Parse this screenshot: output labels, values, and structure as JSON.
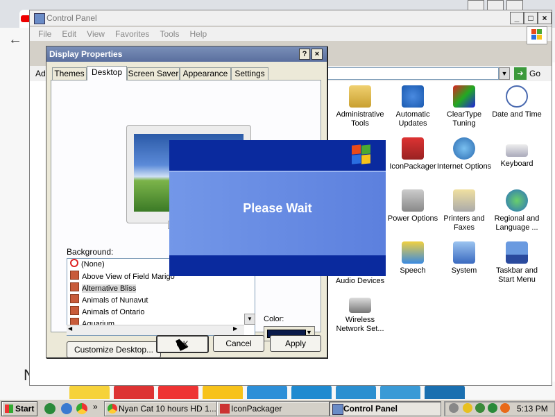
{
  "control_panel": {
    "title": "Control Panel",
    "menu": [
      "File",
      "Edit",
      "View",
      "Favorites",
      "Tools",
      "Help"
    ],
    "address_prefix": "Ad",
    "go_label": "Go",
    "items": [
      {
        "label": "Administrative Tools",
        "icon": "admin-tools-icon"
      },
      {
        "label": "Automatic Updates",
        "icon": "windows-update-icon"
      },
      {
        "label": "ClearType Tuning",
        "icon": "cleartype-icon"
      },
      {
        "label": "Date and Time",
        "icon": "clock-icon"
      },
      {
        "label": "IconPackager",
        "icon": "iconpackager-icon"
      },
      {
        "label": "Internet Options",
        "icon": "globe-icon"
      },
      {
        "label": "Keyboard",
        "icon": "keyboard-icon"
      },
      {
        "label": "Power Options",
        "icon": "power-icon"
      },
      {
        "label": "Printers and Faxes",
        "icon": "printer-icon"
      },
      {
        "label": "Regional and Language ...",
        "icon": "regional-globe-icon"
      },
      {
        "label": "Audio Devices",
        "icon": "audio-icon"
      },
      {
        "label": "Speech",
        "icon": "speech-icon"
      },
      {
        "label": "System",
        "icon": "system-icon"
      },
      {
        "label": "Taskbar and Start Menu",
        "icon": "taskbar-icon"
      },
      {
        "label": "Wireless Network Set...",
        "icon": "wireless-icon"
      }
    ]
  },
  "display_properties": {
    "title": "Display Properties",
    "help_btn": "?",
    "close_btn": "×",
    "tabs": [
      "Themes",
      "Desktop",
      "Screen Saver",
      "Appearance",
      "Settings"
    ],
    "active_tab": "Desktop",
    "background_label": "Background:",
    "backgrounds": [
      "(None)",
      "Above View of Field Marigo",
      "Alternative Bliss",
      "Animals of Nunavut",
      "Animals of Ontario",
      "Aquarium"
    ],
    "selected_background": "Alternative Bliss",
    "color_label": "Color:",
    "color_value": "#0a1a4a",
    "customize_label": "Customize Desktop...",
    "ok_label": "OK",
    "cancel_label": "Cancel",
    "apply_label": "Apply"
  },
  "splash": {
    "text": "Please Wait"
  },
  "chrome": {
    "partial_text": "N"
  },
  "taskbar": {
    "start_label": "Start",
    "chevron": "»",
    "tasks": [
      {
        "label": "Nyan Cat 10 hours HD 1...",
        "active": false
      },
      {
        "label": "IconPackager",
        "active": false
      },
      {
        "label": "Control Panel",
        "active": true
      }
    ],
    "clock": "5:13 PM"
  }
}
